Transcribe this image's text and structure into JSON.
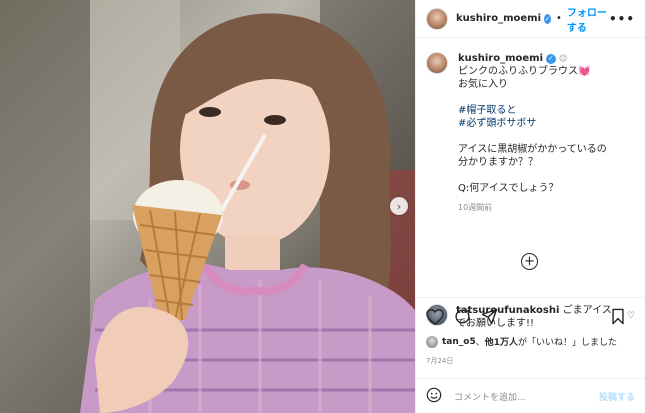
{
  "header": {
    "username": "kushiro_moemi",
    "follow_label": "フォローする",
    "more_label": "•••"
  },
  "caption": {
    "username": "kushiro_moemi",
    "line1": "ピンクのふりふりブラウス💓",
    "line2": "お気に入り",
    "tag1": "#帽子取ると",
    "tag2": "#必ず頭ボサボサ",
    "line3": "アイスに黒胡椒がかかっているの",
    "line4": "分かりますか？？",
    "line5": "Q:何アイスでしょう？",
    "time_ago": "10週間前"
  },
  "reply": {
    "username": "tatsuroufunakoshi",
    "text": "ごまアイスでお願いします!!"
  },
  "likes": {
    "user": "tan_o5",
    "text_mid": "、",
    "count_text": "他1万人",
    "text_end": "が「いいね！」しました"
  },
  "post_date": "7月24日",
  "comment_box": {
    "placeholder": "コメントを追加...",
    "post_label": "投稿する"
  },
  "colors": {
    "accent": "#0095f6",
    "verified": "#3897f0",
    "hashtag": "#00376b",
    "muted": "#8e8e8e"
  },
  "icons": [
    "verified-badge-icon",
    "more-options-icon",
    "plus-circle-icon",
    "heart-icon",
    "comment-icon",
    "share-icon",
    "bookmark-icon",
    "emoji-icon",
    "next-arrow-icon"
  ]
}
